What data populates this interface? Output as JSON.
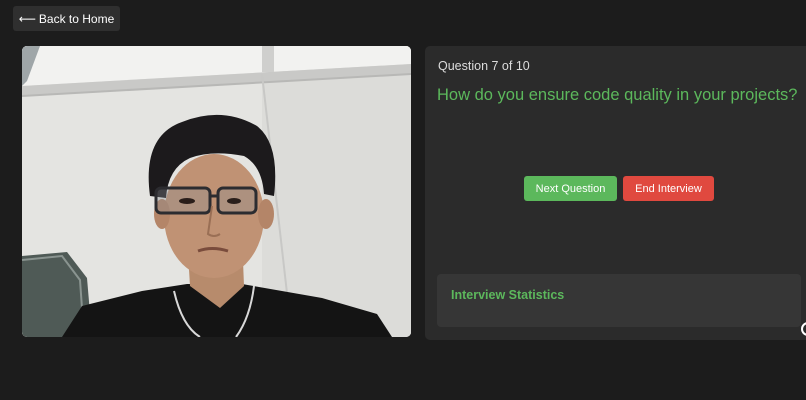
{
  "nav": {
    "back_arrow": "⟵",
    "back_label": "Back to Home"
  },
  "question": {
    "counter": "Question 7 of 10",
    "text": "How do you ensure code quality in your projects?"
  },
  "actions": {
    "next_label": "Next Question",
    "end_label": "End Interview"
  },
  "stats": {
    "title": "Interview Statistics"
  },
  "colors": {
    "background": "#1c1c1c",
    "panel": "#2b2b2b",
    "accent_green": "#5cb85c",
    "danger_red": "#e0493f"
  }
}
